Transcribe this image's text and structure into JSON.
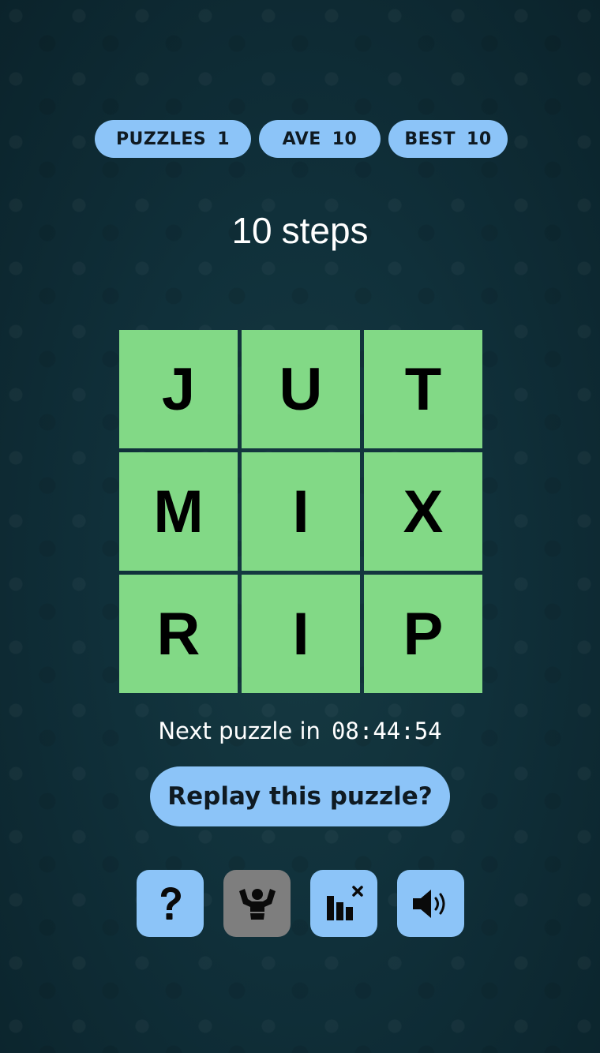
{
  "stats": {
    "puzzles": {
      "label": "PUZZLES",
      "value": "1"
    },
    "ave": {
      "label": "AVE",
      "value": "10"
    },
    "best": {
      "label": "BEST",
      "value": "10"
    }
  },
  "steps": {
    "count": "10",
    "label": "steps"
  },
  "board": {
    "tiles": [
      "J",
      "U",
      "T",
      "M",
      "I",
      "X",
      "R",
      "I",
      "P"
    ],
    "tile_color": "#82d986"
  },
  "timer": {
    "label": "Next puzzle in",
    "value": "08:44:54"
  },
  "replay": {
    "label": "Replay this puzzle?"
  },
  "toolbar": {
    "help_icon": "question-mark-icon",
    "strength_icon": "flexed-arms-icon",
    "stats_icon": "bar-chart-close-icon",
    "sound_icon": "speaker-volume-icon"
  },
  "colors": {
    "accent": "#8cc4f8",
    "background": "#10303a",
    "disabled": "#7e7e7e"
  }
}
